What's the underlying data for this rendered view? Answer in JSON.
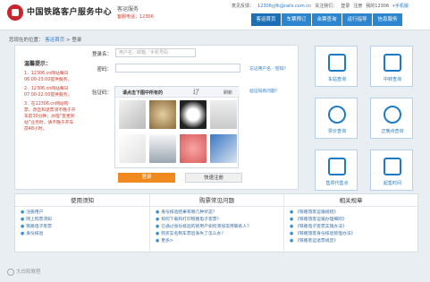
{
  "header": {
    "site_title": "中国铁路客户服务中心",
    "subtitle": "客运服务",
    "hotline": "客服电话：12306",
    "topbar": {
      "greeting": "意见反馈：",
      "email": "12306yjfk@rails.com.cn",
      "follow": "关注我们：",
      "my_12306": "我的12306",
      "login": "登录",
      "register": "注册"
    },
    "phone_version": "手机版",
    "nav": [
      "客运首页",
      "车票预订",
      "余票查询",
      "运行指导",
      "信息服务"
    ]
  },
  "breadcrumb": {
    "prefix": "您现在的位置：",
    "home": "客运首页",
    "sep": ">",
    "current": "登录"
  },
  "tips": {
    "title": "温馨提示：",
    "items": [
      "1．12306.cn网站每日06:00-23:00提供服务。",
      "2．12306.cn网站每日07:00-22:00提供服务。",
      "3．在12306.cn网站购票，改签和退票须不晚于开车前30分钟；办理“变更到站”业务时，请不晚于开车前48小时。"
    ]
  },
  "form": {
    "username_label": "登录名：",
    "username_placeholder": "用户名／邮箱／手机号码",
    "password_label": "密码：",
    "password_placeholder": "",
    "captcha_label": "验证码：",
    "forgot_username": "忘记用户名／密码？",
    "captcha_help": "验证码有问题？",
    "captcha_question": "请点击下图中所有的",
    "captcha_answer": "",
    "captcha_target": "订",
    "refresh": "刷新",
    "login_button": "登录",
    "register_button": "快速注册"
  },
  "services": [
    {
      "label": "车站查询",
      "icon": "station-icon"
    },
    {
      "label": "中转查询",
      "icon": "transfer-icon"
    },
    {
      "label": "票价查询",
      "icon": "price-icon"
    },
    {
      "label": "正晚点查询",
      "icon": "clock-icon"
    },
    {
      "label": "售票代售点",
      "icon": "ticket-office-icon"
    },
    {
      "label": "起售时间",
      "icon": "calendar-icon"
    }
  ],
  "info": {
    "columns": [
      {
        "title": "使用须知",
        "items": [
          "注册用户",
          "网上购票须知",
          "铁路电子客票",
          "身份核验"
        ]
      },
      {
        "title": "购票常见问题",
        "items": [
          "身份核验结果有哪几种状态？",
          "如何下载和打印铁路电子客票？",
          "已通过身份核验的新用户如何添加常用联系人？",
          "购买实名制车票后丢失了怎么办？",
          "更多>"
        ]
      },
      {
        "title": "相关规章",
        "items": [
          "《铁路旅客运输规程》",
          "《铁路旅客运输办理细则》",
          "《铁路电子客票实施办法》",
          "《铁路旅客身份核验管理办法》",
          "《铁路客运退票规定》"
        ]
      }
    ]
  },
  "watermark": "大白阳教程",
  "colors": {
    "accent": "#2b85cf",
    "login_orange": "#f08a1f",
    "warning_red": "#c63d2d",
    "logo_red": "#c8252c"
  }
}
